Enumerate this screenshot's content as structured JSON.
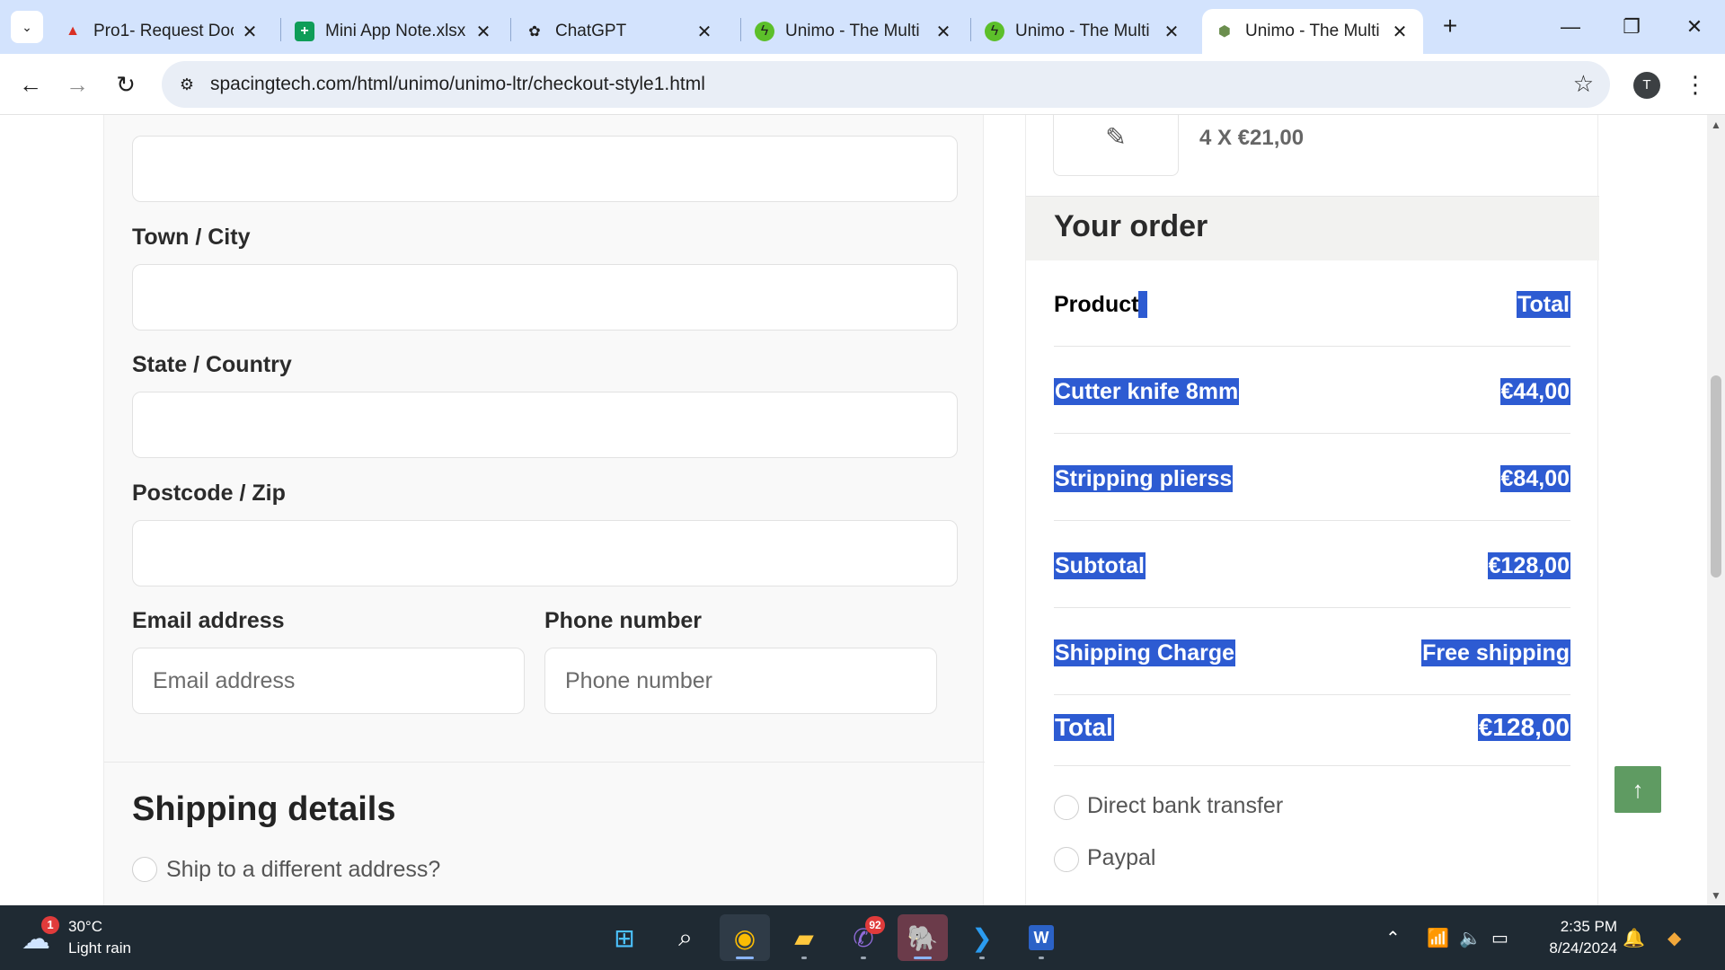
{
  "browser": {
    "tabs": [
      {
        "title": "Pro1- Request Doc",
        "favicon": "document-favicon",
        "color": "#d93025"
      },
      {
        "title": "Mini App Note.xlsx",
        "favicon": "sheets-favicon",
        "color": "#0f9d58"
      },
      {
        "title": "ChatGPT",
        "favicon": "chatgpt-favicon",
        "color": "#1f1f1f"
      },
      {
        "title": "Unimo - The Multi",
        "favicon": "unimo-favicon",
        "color": "#5cbf2a"
      },
      {
        "title": "Unimo - The Multi",
        "favicon": "unimo-favicon",
        "color": "#5cbf2a"
      },
      {
        "title": "Unimo - The Multi",
        "favicon": "unimo-hex-favicon",
        "color": "#6b8e4e",
        "active": true
      }
    ],
    "url": "spacingtech.com/html/unimo/unimo-ltr/checkout-style1.html",
    "profile_initial": "T"
  },
  "billing": {
    "town_label": "Town / City",
    "state_label": "State / Country",
    "postcode_label": "Postcode / Zip",
    "email_label": "Email address",
    "email_placeholder": "Email address",
    "phone_label": "Phone number",
    "phone_placeholder": "Phone number"
  },
  "shipping": {
    "title": "Shipping details",
    "ship_different": "Ship to a different address?"
  },
  "cart_item": {
    "qty_price": "4 X €21,00"
  },
  "order": {
    "title": "Your order",
    "header": {
      "product": "Product",
      "total": "Total"
    },
    "items": [
      {
        "name": "Cutter knife 8mm",
        "price": "€44,00"
      },
      {
        "name": "Stripping plierss",
        "price": "€84,00"
      }
    ],
    "subtotal": {
      "label": "Subtotal",
      "value": "€128,00"
    },
    "shipping": {
      "label": "Shipping Charge",
      "value": "Free shipping"
    },
    "total": {
      "label": "Total",
      "value": "€128,00"
    },
    "payment_methods": [
      "Direct bank transfer",
      "Paypal"
    ]
  },
  "taskbar": {
    "weather": {
      "badge": "1",
      "temp": "30°C",
      "condition": "Light rain"
    },
    "viber_badge": "92",
    "time": "2:35 PM",
    "date": "8/24/2024"
  },
  "colors": {
    "selection": "#2d5bd2",
    "scroll_top_button": "#5f9b62",
    "tab_bar": "#d3e3fd"
  }
}
